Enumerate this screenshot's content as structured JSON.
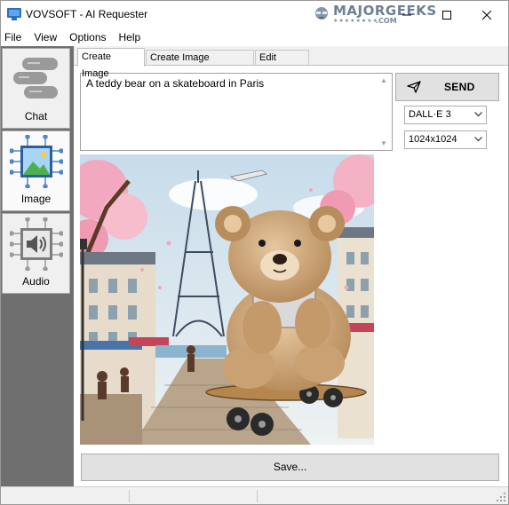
{
  "window": {
    "title": "VOVSOFT - AI Requester"
  },
  "watermark": {
    "brand": "MAJORGEEKS",
    "domain": ".COM"
  },
  "menu": [
    "File",
    "View",
    "Options",
    "Help"
  ],
  "sidebar": {
    "items": [
      {
        "label": "Chat",
        "icon": "chat-bubbles-icon"
      },
      {
        "label": "Image",
        "icon": "image-circuit-icon"
      },
      {
        "label": "Audio",
        "icon": "speaker-circuit-icon"
      }
    ],
    "active": "Image"
  },
  "tabs": [
    {
      "label": "Create Image",
      "active": true
    },
    {
      "label": "Create Image Variation",
      "active": false
    },
    {
      "label": "Edit Image",
      "active": false
    }
  ],
  "prompt": {
    "value": "A teddy bear on a skateboard in Paris"
  },
  "send": {
    "label": "SEND"
  },
  "model_select": {
    "value": "DALL·E 3"
  },
  "size_select": {
    "value": "1024x1024"
  },
  "image": {
    "description": "generated-image"
  },
  "save": {
    "label": "Save..."
  },
  "colors": {
    "sidebar": "#6f6f6f",
    "accent": "#0078d7"
  }
}
